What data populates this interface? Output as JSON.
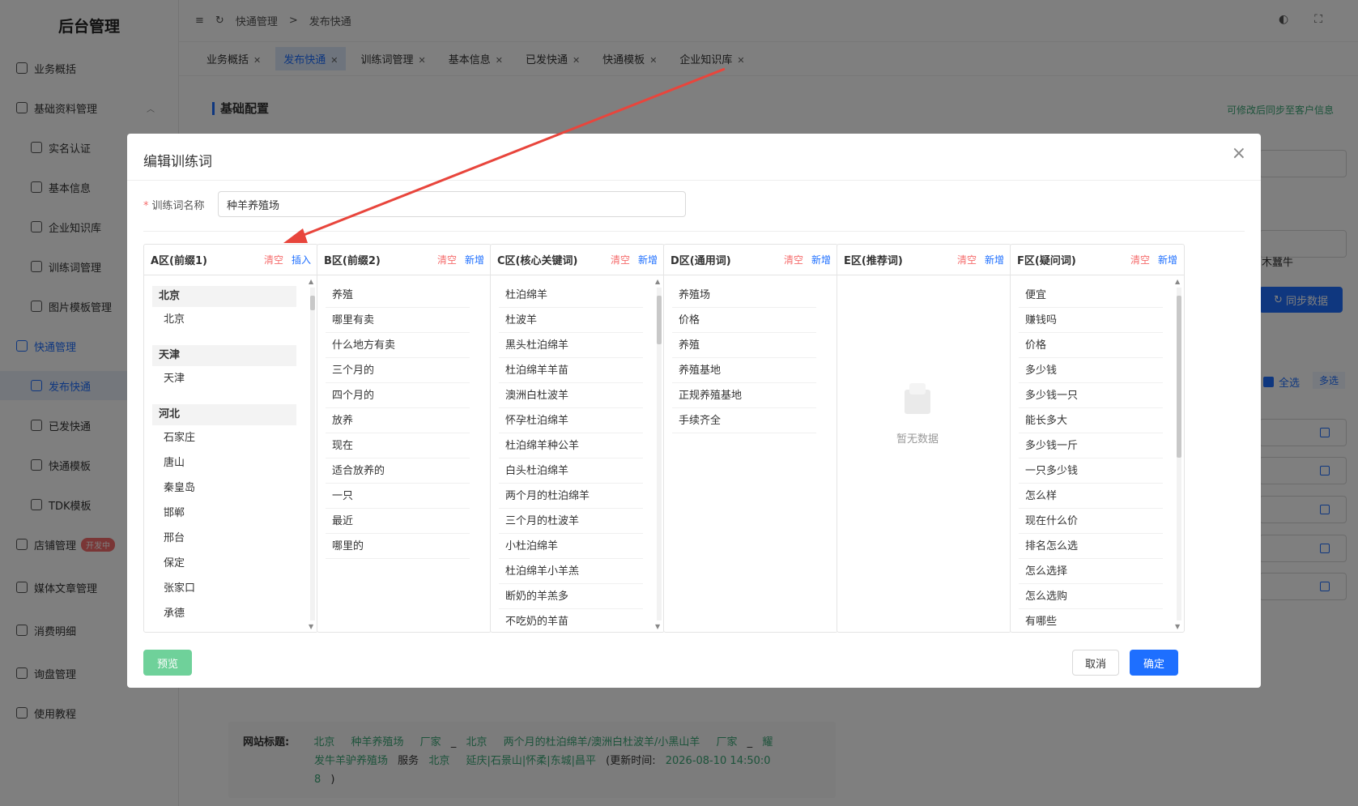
{
  "sidebar": {
    "logo": "后台管理",
    "items": [
      {
        "label": "业务概括",
        "icon": "chart-icon"
      },
      {
        "label": "基础资料管理",
        "icon": "user-folder-icon"
      },
      {
        "label": "实名认证",
        "icon": "id-card-icon"
      },
      {
        "label": "基本信息",
        "icon": "user-icon"
      },
      {
        "label": "企业知识库",
        "icon": "book-icon"
      },
      {
        "label": "训练词管理",
        "icon": "target-icon"
      },
      {
        "label": "图片模板管理",
        "icon": "image-icon"
      },
      {
        "label": "快通管理",
        "icon": "rocket-icon"
      },
      {
        "label": "发布快通",
        "icon": "lightning-icon"
      },
      {
        "label": "已发快通",
        "icon": "list-icon"
      },
      {
        "label": "快通模板",
        "icon": "template-icon"
      },
      {
        "label": "TDK模板",
        "icon": "doc-icon"
      },
      {
        "label": "店铺管理",
        "icon": "shop-icon"
      },
      {
        "label": "媒体文章管理",
        "icon": "media-icon"
      },
      {
        "label": "消费明细",
        "icon": "receipt-icon"
      },
      {
        "label": "询盘管理",
        "icon": "chat-icon"
      },
      {
        "label": "使用教程",
        "icon": "video-icon"
      }
    ],
    "badge": "开发中"
  },
  "header": {
    "breadcrumb": [
      "快通管理",
      "发布快通"
    ],
    "sep": ">"
  },
  "tabs": [
    "业务概括",
    "发布快通",
    "训练词管理",
    "基本信息",
    "已发快通",
    "快通模板",
    "企业知识库"
  ],
  "background": {
    "section_title": "基础配置",
    "sync_note": "可修改后同步至客户信息",
    "sync_button": "同步数据",
    "right_text": "木蠶牛",
    "select_all": "全选",
    "multi": "多选",
    "footer": {
      "label": "网站标题:",
      "line1": [
        "北京",
        "种羊养殖场",
        "厂家",
        "_",
        "北京",
        "两个月的杜泊绵羊/澳洲白杜波羊/小黑山羊",
        "厂家",
        "_",
        "耀"
      ],
      "line2_a": "发牛羊驴养殖场",
      "line2_b": "服务",
      "line2_c": "北京",
      "line2_d": "延庆|石景山|怀柔|东城|昌平",
      "line2_e": "(更新时间:",
      "line2_f": "2026-08-10 14:50:0",
      "line3_a": "8",
      "line3_b": ")"
    }
  },
  "modal": {
    "title": "编辑训练词",
    "name_label": "训练词名称",
    "name_value": "种羊养殖场",
    "clear": "清空",
    "insert": "插入",
    "add": "新增",
    "empty_text": "暂无数据",
    "preview": "预览",
    "cancel": "取消",
    "ok": "确定",
    "columns": [
      {
        "title": "A区(前缀1)",
        "groups": [
          {
            "name": "北京",
            "items": [
              "北京"
            ]
          },
          {
            "name": "天津",
            "items": [
              "天津"
            ]
          },
          {
            "name": "河北",
            "items": [
              "石家庄",
              "唐山",
              "秦皇岛",
              "邯郸",
              "邢台",
              "保定",
              "张家口",
              "承德"
            ]
          }
        ]
      },
      {
        "title": "B区(前缀2)",
        "items": [
          "养殖",
          "哪里有卖",
          "什么地方有卖",
          "三个月的",
          "四个月的",
          "放养",
          "现在",
          "适合放养的",
          "一只",
          "最近",
          "哪里的"
        ]
      },
      {
        "title": "C区(核心关键词)",
        "items": [
          "杜泊绵羊",
          "杜波羊",
          "黑头杜泊绵羊",
          "杜泊绵羊羊苗",
          "澳洲白杜波羊",
          "怀孕杜泊绵羊",
          "杜泊绵羊种公羊",
          "白头杜泊绵羊",
          "两个月的杜泊绵羊",
          "三个月的杜波羊",
          "小杜泊绵羊",
          "杜泊绵羊小羊羔",
          "断奶的羊羔多",
          "不吃奶的羊苗"
        ]
      },
      {
        "title": "D区(通用词)",
        "items": [
          "养殖场",
          "价格",
          "养殖",
          "养殖基地",
          "正规养殖基地",
          "手续齐全"
        ]
      },
      {
        "title": "E区(推荐词)",
        "items": []
      },
      {
        "title": "F区(疑问词)",
        "items": [
          "便宜",
          "赚钱吗",
          "价格",
          "多少钱",
          "多少钱一只",
          "能长多大",
          "多少钱一斤",
          "一只多少钱",
          "怎么样",
          "现在什么价",
          "排名怎么选",
          "怎么选择",
          "怎么选购",
          "有哪些"
        ]
      }
    ]
  },
  "colors": {
    "primary": "#1e6fff",
    "danger": "#f56c6c",
    "success": "#3aa676",
    "annotation_arrow": "#e8453c"
  }
}
